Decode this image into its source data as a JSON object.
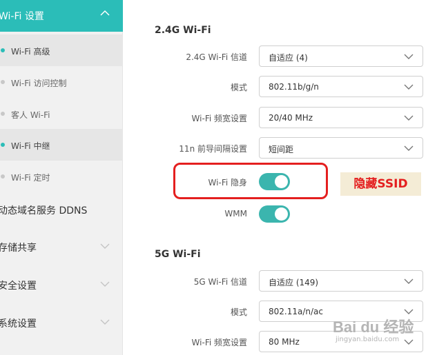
{
  "sidebar": {
    "header": {
      "label": "Wi-Fi 设置",
      "icon": "chevron-up-icon"
    },
    "sub_items": [
      {
        "label": "Wi-Fi 高级",
        "active": true
      },
      {
        "label": "Wi-Fi 访问控制",
        "active": false
      },
      {
        "label": "客人 Wi-Fi",
        "active": false
      },
      {
        "label": "Wi-Fi 中继",
        "active": true
      },
      {
        "label": "Wi-Fi 定时",
        "active": false
      }
    ],
    "main_items": [
      {
        "label": "动态域名服务 DDNS"
      },
      {
        "label": "存储共享",
        "icon": "chevron-down-icon"
      },
      {
        "label": "安全设置",
        "icon": "chevron-down-icon"
      },
      {
        "label": "系统设置",
        "icon": "chevron-down-icon"
      }
    ]
  },
  "wifi24": {
    "title": "2.4G Wi-Fi",
    "rows": [
      {
        "label": "2.4G Wi-Fi 信道",
        "value": "自适应 (4)"
      },
      {
        "label": "模式",
        "value": "802.11b/g/n"
      },
      {
        "label": "Wi-Fi 频宽设置",
        "value": "20/40 MHz"
      },
      {
        "label": "11n 前导间隔设置",
        "value": "短间距"
      }
    ],
    "hide_ssid": {
      "label": "Wi-Fi 隐身",
      "on": true
    },
    "wmm": {
      "label": "WMM",
      "on": true
    }
  },
  "annotation": "隐藏SSID",
  "wifi5": {
    "title": "5G Wi-Fi",
    "rows": [
      {
        "label": "5G Wi-Fi 信道",
        "value": "自适应 (149)"
      },
      {
        "label": "模式",
        "value": "802.11a/n/ac"
      },
      {
        "label": "Wi-Fi 频宽设置",
        "value": "80 MHz"
      }
    ]
  },
  "watermark": {
    "logo": "Bai du 经验",
    "url": "jingyan.baidu.com"
  },
  "colors": {
    "accent": "#2bbdb8",
    "toggle": "#3bb5ae",
    "highlight": "#e41f1f"
  }
}
